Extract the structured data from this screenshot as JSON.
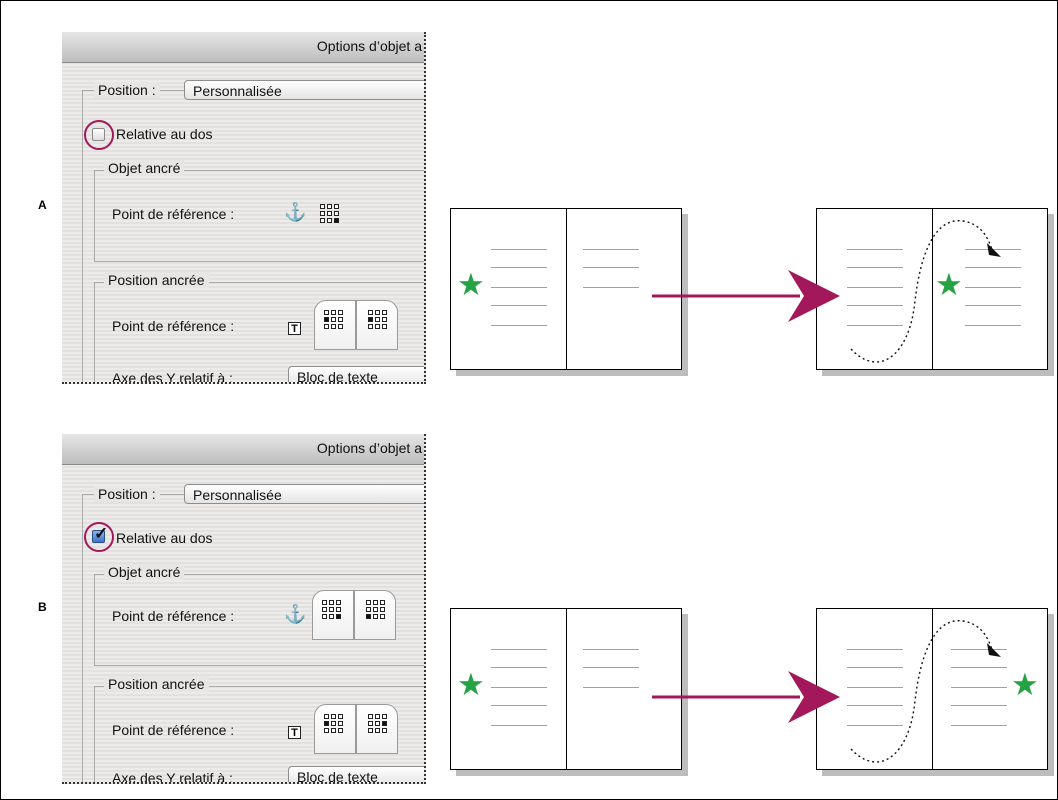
{
  "panels": [
    {
      "label": "A",
      "dialog_title": "Options d’objet a",
      "position_label": "Position :",
      "position_value": "Personnalisée",
      "relative_to_spine": "Relative au dos",
      "relative_checked": false,
      "anchored_object_group": "Objet ancré",
      "anchored_reference_label": "Point de référence :",
      "anchored_position_group": "Position ancrée",
      "anchored_position_reference_label": "Point de référence :",
      "y_relative_label": "Axe des Y relatif à :",
      "y_relative_value": "Bloc de texte"
    },
    {
      "label": "B",
      "dialog_title": "Options d’objet a",
      "position_label": "Position :",
      "position_value": "Personnalisée",
      "relative_to_spine": "Relative au dos",
      "relative_checked": true,
      "anchored_object_group": "Objet ancré",
      "anchored_reference_label": "Point de référence :",
      "anchored_position_group": "Position ancrée",
      "anchored_position_reference_label": "Point de référence :",
      "y_relative_label": "Axe des Y relatif à :",
      "y_relative_value": "Bloc de texte"
    }
  ],
  "colors": {
    "arrow": "#a3185a",
    "star": "#25a244",
    "highlight_circle": "#a3185a"
  },
  "icons": [
    "anchor-icon",
    "text-frame-icon",
    "reference-point-grid-icon",
    "star-icon",
    "dotted-path-arrow-icon"
  ]
}
